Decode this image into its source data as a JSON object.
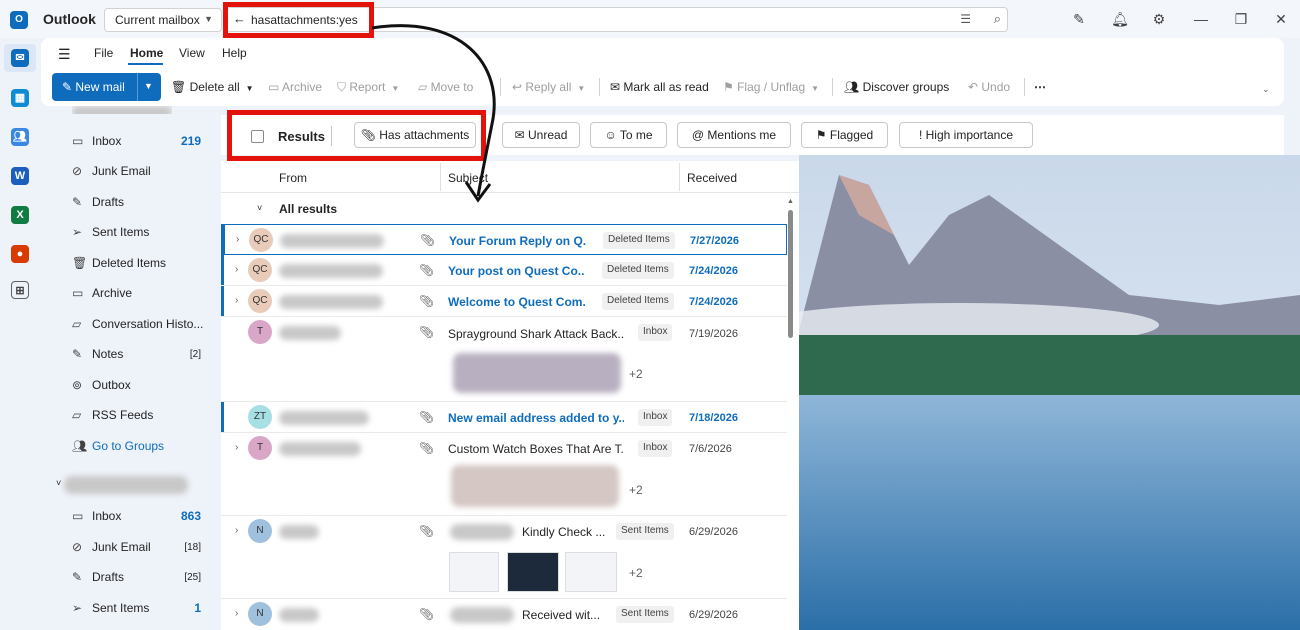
{
  "app": {
    "title": "Outlook",
    "logo_letter": "O"
  },
  "search": {
    "scope": "Current mailbox",
    "query": "hasattachments:yes"
  },
  "menu": {
    "tabs": [
      "File",
      "Home",
      "View",
      "Help"
    ],
    "active": "Home"
  },
  "toolbar": {
    "new_mail": "New mail",
    "delete_all": "Delete all",
    "archive": "Archive",
    "report": "Report",
    "move_to": "Move to",
    "reply_all": "Reply all",
    "mark_all_read": "Mark all as read",
    "flag_unflag": "Flag / Unflag",
    "discover_groups": "Discover groups",
    "undo": "Undo",
    "more": "⋯"
  },
  "folders_top": [
    {
      "name": "Inbox",
      "count": "219",
      "style": "blue"
    },
    {
      "name": "Junk Email",
      "count": ""
    },
    {
      "name": "Drafts",
      "count": ""
    },
    {
      "name": "Sent Items",
      "count": ""
    },
    {
      "name": "Deleted Items",
      "count": ""
    },
    {
      "name": "Archive",
      "count": ""
    },
    {
      "name": "Conversation Histo...",
      "count": ""
    },
    {
      "name": "Notes",
      "count": "[2]",
      "style": "small"
    },
    {
      "name": "Outbox",
      "count": ""
    },
    {
      "name": "RSS Feeds",
      "count": ""
    },
    {
      "name": "Go to Groups",
      "count": "",
      "style": "link"
    }
  ],
  "folders_bottom": [
    {
      "name": "Inbox",
      "count": "863",
      "style": "blue"
    },
    {
      "name": "Junk Email",
      "count": "[18]",
      "style": "small"
    },
    {
      "name": "Drafts",
      "count": "[25]",
      "style": "small"
    },
    {
      "name": "Sent Items",
      "count": "1",
      "style": "blue"
    }
  ],
  "filters": {
    "results": "Results",
    "pills": [
      "Has attachments",
      "Unread",
      "To me",
      "Mentions me",
      "Flagged",
      "High importance"
    ]
  },
  "columns": {
    "from": "From",
    "subject": "Subject",
    "received": "Received"
  },
  "group_label": "All results",
  "messages": [
    {
      "initials": "QC",
      "subject": "Your Forum Reply on Q...",
      "tag": "Deleted Items",
      "date": "7/27/2026",
      "unread": true
    },
    {
      "initials": "QC",
      "subject": "Your post on Quest Co...",
      "tag": "Deleted Items",
      "date": "7/24/2026",
      "unread": true
    },
    {
      "initials": "QC",
      "subject": "Welcome to Quest Com...",
      "tag": "Deleted Items",
      "date": "7/24/2026",
      "unread": true
    },
    {
      "initials": "T",
      "subject": "Sprayground Shark Attack Back...",
      "tag": "Inbox",
      "date": "7/19/2026",
      "unread": false,
      "more": "+2"
    },
    {
      "initials": "ZT",
      "subject": "New email address added to y...",
      "tag": "Inbox",
      "date": "7/18/2026",
      "unread": true
    },
    {
      "initials": "T",
      "subject": "Custom Watch Boxes That Are T...",
      "tag": "Inbox",
      "date": "7/6/2026",
      "unread": false,
      "more": "+2"
    },
    {
      "initials": "N",
      "subject": "Kindly Check ...",
      "tag": "Sent Items",
      "date": "6/29/2026",
      "unread": false,
      "more": "+2"
    },
    {
      "initials": "N",
      "subject": "Received wit...",
      "tag": "Sent Items",
      "date": "6/29/2026",
      "unread": false
    }
  ],
  "colors": {
    "accent": "#0f6cbd",
    "highlight": "#e3120b"
  }
}
